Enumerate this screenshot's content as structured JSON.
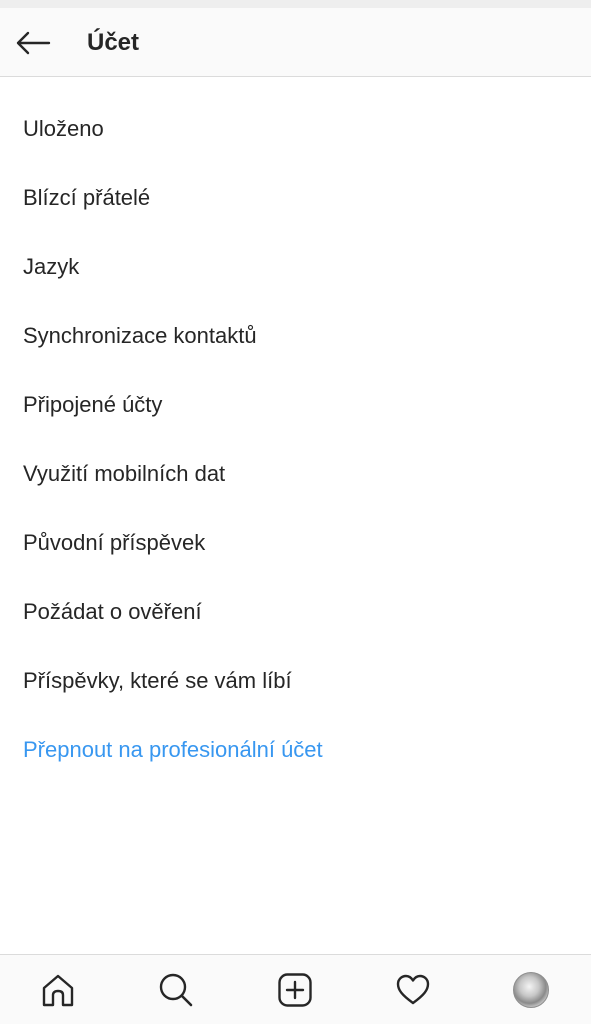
{
  "header": {
    "title": "Účet",
    "back_icon": "arrow-left-icon"
  },
  "menu": {
    "items": [
      {
        "label": "Uloženo"
      },
      {
        "label": "Blízcí přátelé"
      },
      {
        "label": "Jazyk"
      },
      {
        "label": "Synchronizace kontaktů"
      },
      {
        "label": "Připojené účty"
      },
      {
        "label": "Využití mobilních dat"
      },
      {
        "label": "Původní příspěvek"
      },
      {
        "label": "Požádat o ověření"
      },
      {
        "label": "Příspěvky, které se vám líbí"
      },
      {
        "label": "Přepnout na profesionální účet"
      }
    ]
  },
  "bottom_nav": {
    "icons": [
      "home-icon",
      "search-icon",
      "add-post-icon",
      "heart-icon",
      "avatar"
    ]
  },
  "colors": {
    "text": "#262626",
    "link": "#3897f0",
    "header_bg": "#fafafa",
    "divider": "#dbdbdb"
  }
}
